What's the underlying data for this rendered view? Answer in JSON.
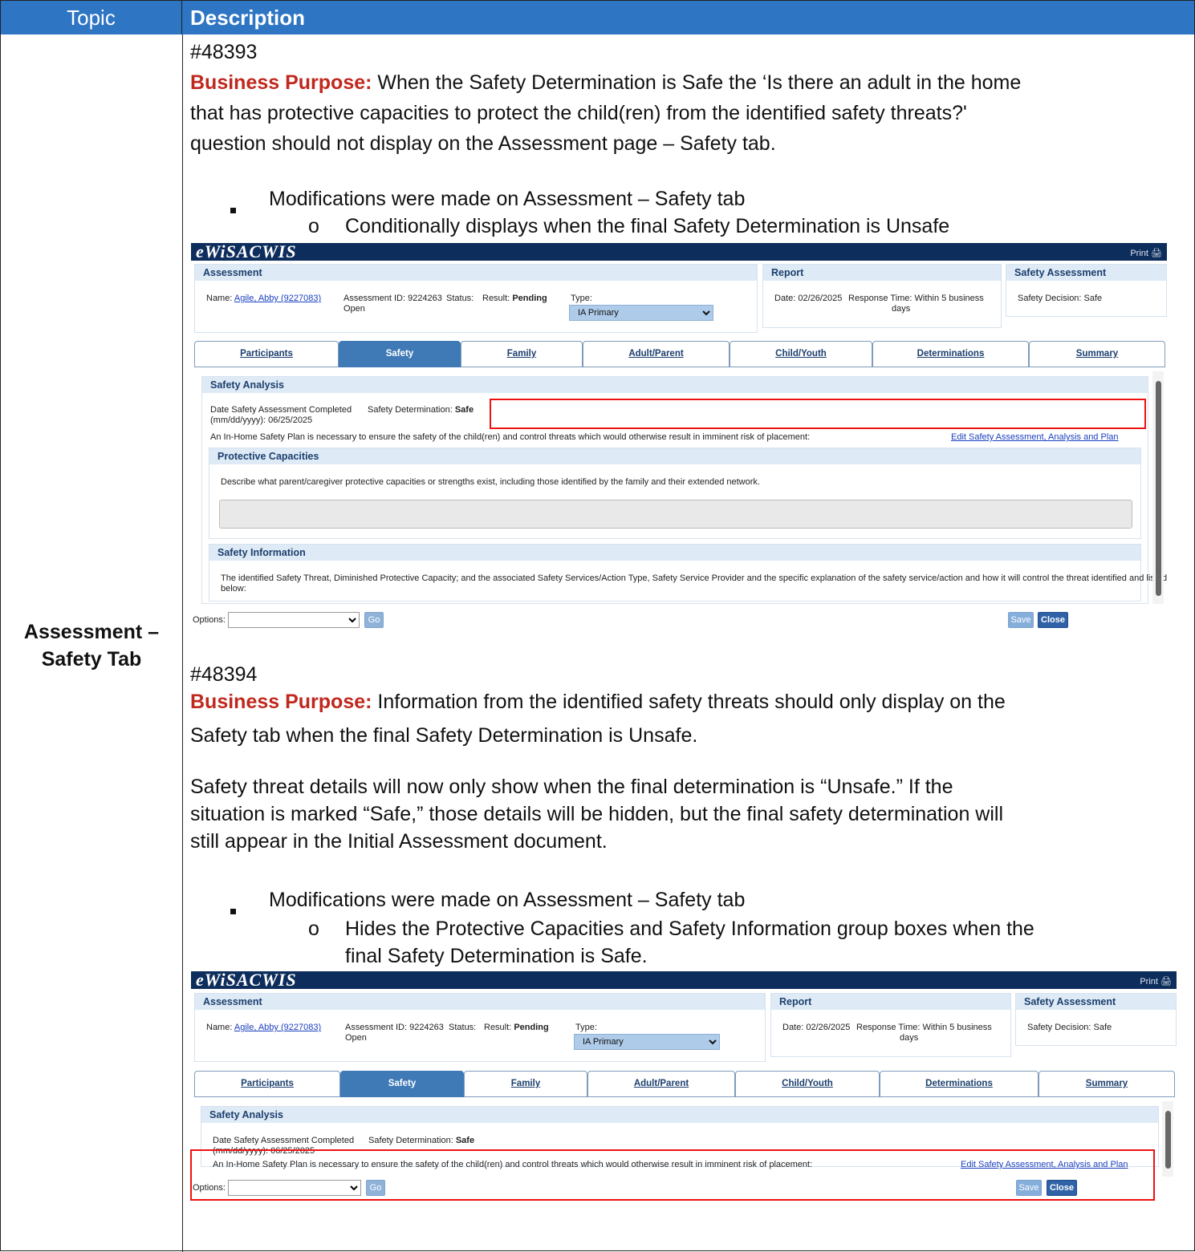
{
  "header": {
    "topic_label": "Topic",
    "description_label": "Description"
  },
  "topic": "Assessment – Safety Tab",
  "section1": {
    "ticket": "#48393",
    "bp_label": "Business Purpose:",
    "bp_line1": " When the Safety Determination is Safe the ‘Is there an adult in the home",
    "bp_line2": "that has protective capacities to protect the child(ren) from the identified safety threats?'",
    "bp_line3": "question should not display on the Assessment page – Safety tab.",
    "bullet": "Modifications were made on Assessment – Safety tab",
    "sub_bullet": "Conditionally displays when the final Safety Determination is Unsafe"
  },
  "section2": {
    "ticket": "#48394",
    "bp_label": "Business Purpose:",
    "bp_line1": " Information from the identified safety threats should only display on the",
    "bp_line2": "Safety tab when the final Safety Determination is Unsafe.",
    "para_line1": "Safety threat details will now only show when the final determination is “Unsafe.” If the",
    "para_line2": "situation is marked “Safe,” those details will be hidden, but the final safety determination will",
    "para_line3": "still appear in the Initial Assessment document.",
    "bullet": "Modifications were made on Assessment – Safety tab",
    "sub_bullet_line1": "Hides the Protective Capacities and Safety Information group boxes when the",
    "sub_bullet_line2": "final Safety Determination is Safe."
  },
  "app": {
    "logo": "eWiSACWIS",
    "print": "Print",
    "assessment_title": "Assessment",
    "name_label": "Name:",
    "name_link": "Agile, Abby  (9227083)",
    "assessment_id": "Assessment ID: 9224263",
    "status": "Status:",
    "status_value": "Open",
    "result_label": "Result:",
    "result_value": "Pending",
    "type_label": "Type:",
    "type_value": "IA Primary",
    "report_title": "Report",
    "date": "Date:  02/26/2025",
    "response_time": "Response Time:  Within 5 business",
    "response_time2": "days",
    "safety_assessment_title": "Safety Assessment",
    "safety_decision": "Safety Decision:  Safe",
    "tabs": [
      "Participants",
      "Safety",
      "Family",
      "Adult/Parent",
      "Child/Youth",
      "Determinations",
      "Summary"
    ],
    "safety_analysis_title": "Safety Analysis",
    "date_completed_label": "Date Safety Assessment Completed",
    "date_completed_value": "(mm/dd/yyyy): 06/25/2025",
    "safety_determination_label": "Safety Determination:",
    "safety_determination_value": "Safe",
    "in_home_text": "An In-Home Safety Plan is necessary to ensure the safety of the child(ren) and control threats which would otherwise result in imminent risk of placement:",
    "edit_link": "Edit Safety Assessment, Analysis and Plan",
    "protective_title": "Protective Capacities",
    "protective_text": "Describe what parent/caregiver protective capacities or strengths exist, including those identified by the family and their extended network.",
    "safety_info_title": "Safety Information",
    "safety_info_text1": "The identified Safety Threat, Diminished Protective Capacity; and the associated Safety Services/Action Type, Safety Service Provider and the specific explanation of the safety service/action and how it will control the threat identified and listed",
    "safety_info_text2": "below:",
    "options_label": "Options:",
    "go": "Go",
    "save": "Save",
    "close": "Close"
  }
}
